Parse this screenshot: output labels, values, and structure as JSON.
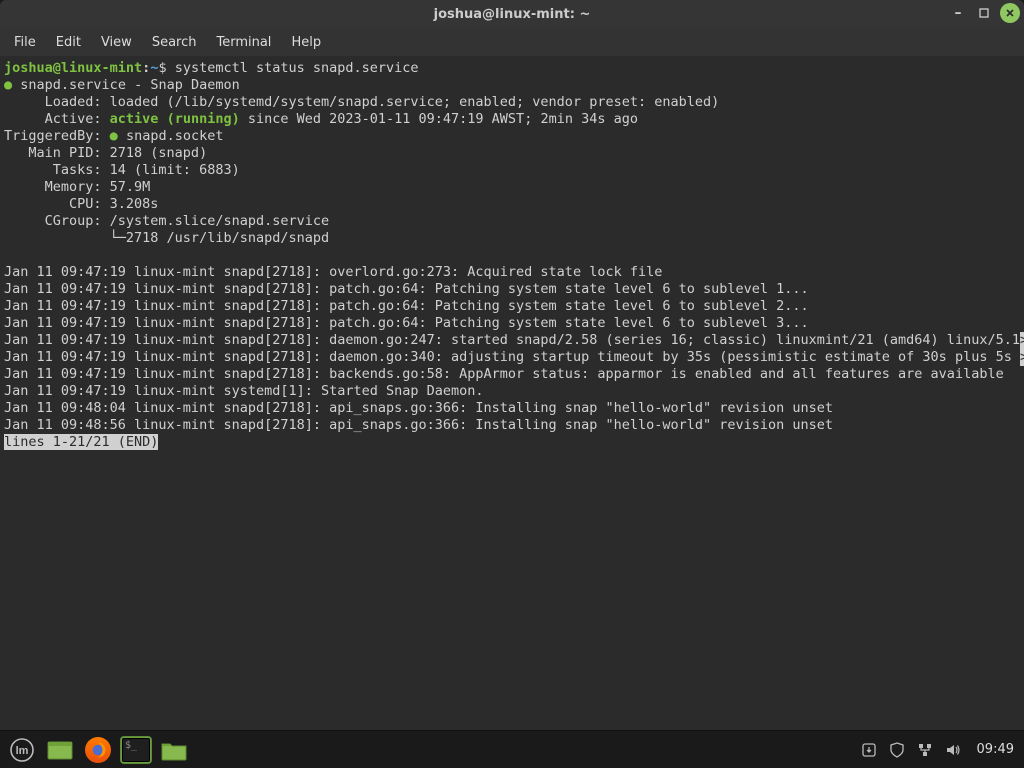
{
  "window": {
    "title": "joshua@linux-mint: ~"
  },
  "menubar": [
    "File",
    "Edit",
    "View",
    "Search",
    "Terminal",
    "Help"
  ],
  "prompt": {
    "user_host": "joshua@linux-mint",
    "path": "~",
    "command": "systemctl status snapd.service"
  },
  "status": {
    "unit_line": "snapd.service - Snap Daemon",
    "loaded": "     Loaded: loaded (/lib/systemd/system/snapd.service; enabled; vendor preset: enabled)",
    "active_label": "     Active: ",
    "active_value": "active (running)",
    "active_rest": " since Wed 2023-01-11 09:47:19 AWST; 2min 34s ago",
    "triggered_label": "TriggeredBy: ",
    "triggered_value": "snapd.socket",
    "main_pid": "   Main PID: 2718 (snapd)",
    "tasks": "      Tasks: 14 (limit: 6883)",
    "memory": "     Memory: 57.9M",
    "cpu": "        CPU: 3.208s",
    "cgroup": "     CGroup: /system.slice/snapd.service",
    "cgroup_child": "             └─2718 /usr/lib/snapd/snapd"
  },
  "logs": [
    "Jan 11 09:47:19 linux-mint snapd[2718]: overlord.go:273: Acquired state lock file",
    "Jan 11 09:47:19 linux-mint snapd[2718]: patch.go:64: Patching system state level 6 to sublevel 1...",
    "Jan 11 09:47:19 linux-mint snapd[2718]: patch.go:64: Patching system state level 6 to sublevel 2...",
    "Jan 11 09:47:19 linux-mint snapd[2718]: patch.go:64: Patching system state level 6 to sublevel 3...",
    "Jan 11 09:47:19 linux-mint snapd[2718]: daemon.go:247: started snapd/2.58 (series 16; classic) linuxmint/21 (amd64) linux/5.1",
    "Jan 11 09:47:19 linux-mint snapd[2718]: daemon.go:340: adjusting startup timeout by 35s (pessimistic estimate of 30s plus 5s ",
    "Jan 11 09:47:19 linux-mint snapd[2718]: backends.go:58: AppArmor status: apparmor is enabled and all features are available",
    "Jan 11 09:47:19 linux-mint systemd[1]: Started Snap Daemon.",
    "Jan 11 09:48:04 linux-mint snapd[2718]: api_snaps.go:366: Installing snap \"hello-world\" revision unset",
    "Jan 11 09:48:56 linux-mint snapd[2718]: api_snaps.go:366: Installing snap \"hello-world\" revision unset"
  ],
  "pager": "lines 1-21/21 (END)",
  "taskbar": {
    "clock": "09:49"
  }
}
